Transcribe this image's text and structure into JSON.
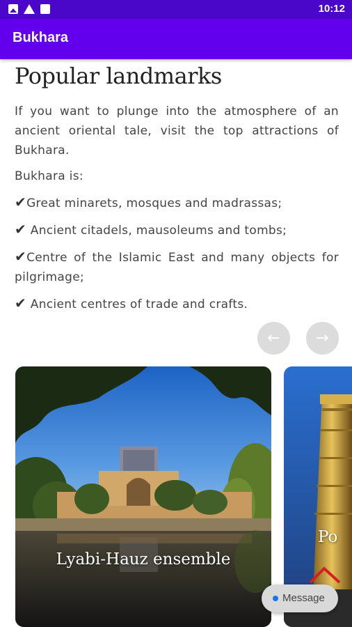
{
  "status_bar": {
    "time": "10:12",
    "icons": [
      "image-icon",
      "warning-icon",
      "alert-icon"
    ]
  },
  "app_bar": {
    "title": "Bukhara",
    "color": "#6200ee"
  },
  "content": {
    "heading": "Popular landmarks",
    "intro": "If you want to plunge into the atmosphere of an ancient oriental tale, visit the top attractions of Bukhara.",
    "lead": "Bukhara is:",
    "checklist": [
      "Great minarets, mosques and madrassas;",
      " Ancient citadels, mausoleums and tombs;",
      "Centre of the Islamic East and many objects for pilgrimage;",
      " Ancient centres of trade and crafts."
    ],
    "check_mark": "✔"
  },
  "carousel": {
    "prev_icon": "←",
    "next_icon": "→",
    "cards": [
      {
        "title": "Lyabi-Hauz ensemble"
      },
      {
        "title": "Po"
      }
    ]
  },
  "message_button": {
    "label": "Message"
  }
}
